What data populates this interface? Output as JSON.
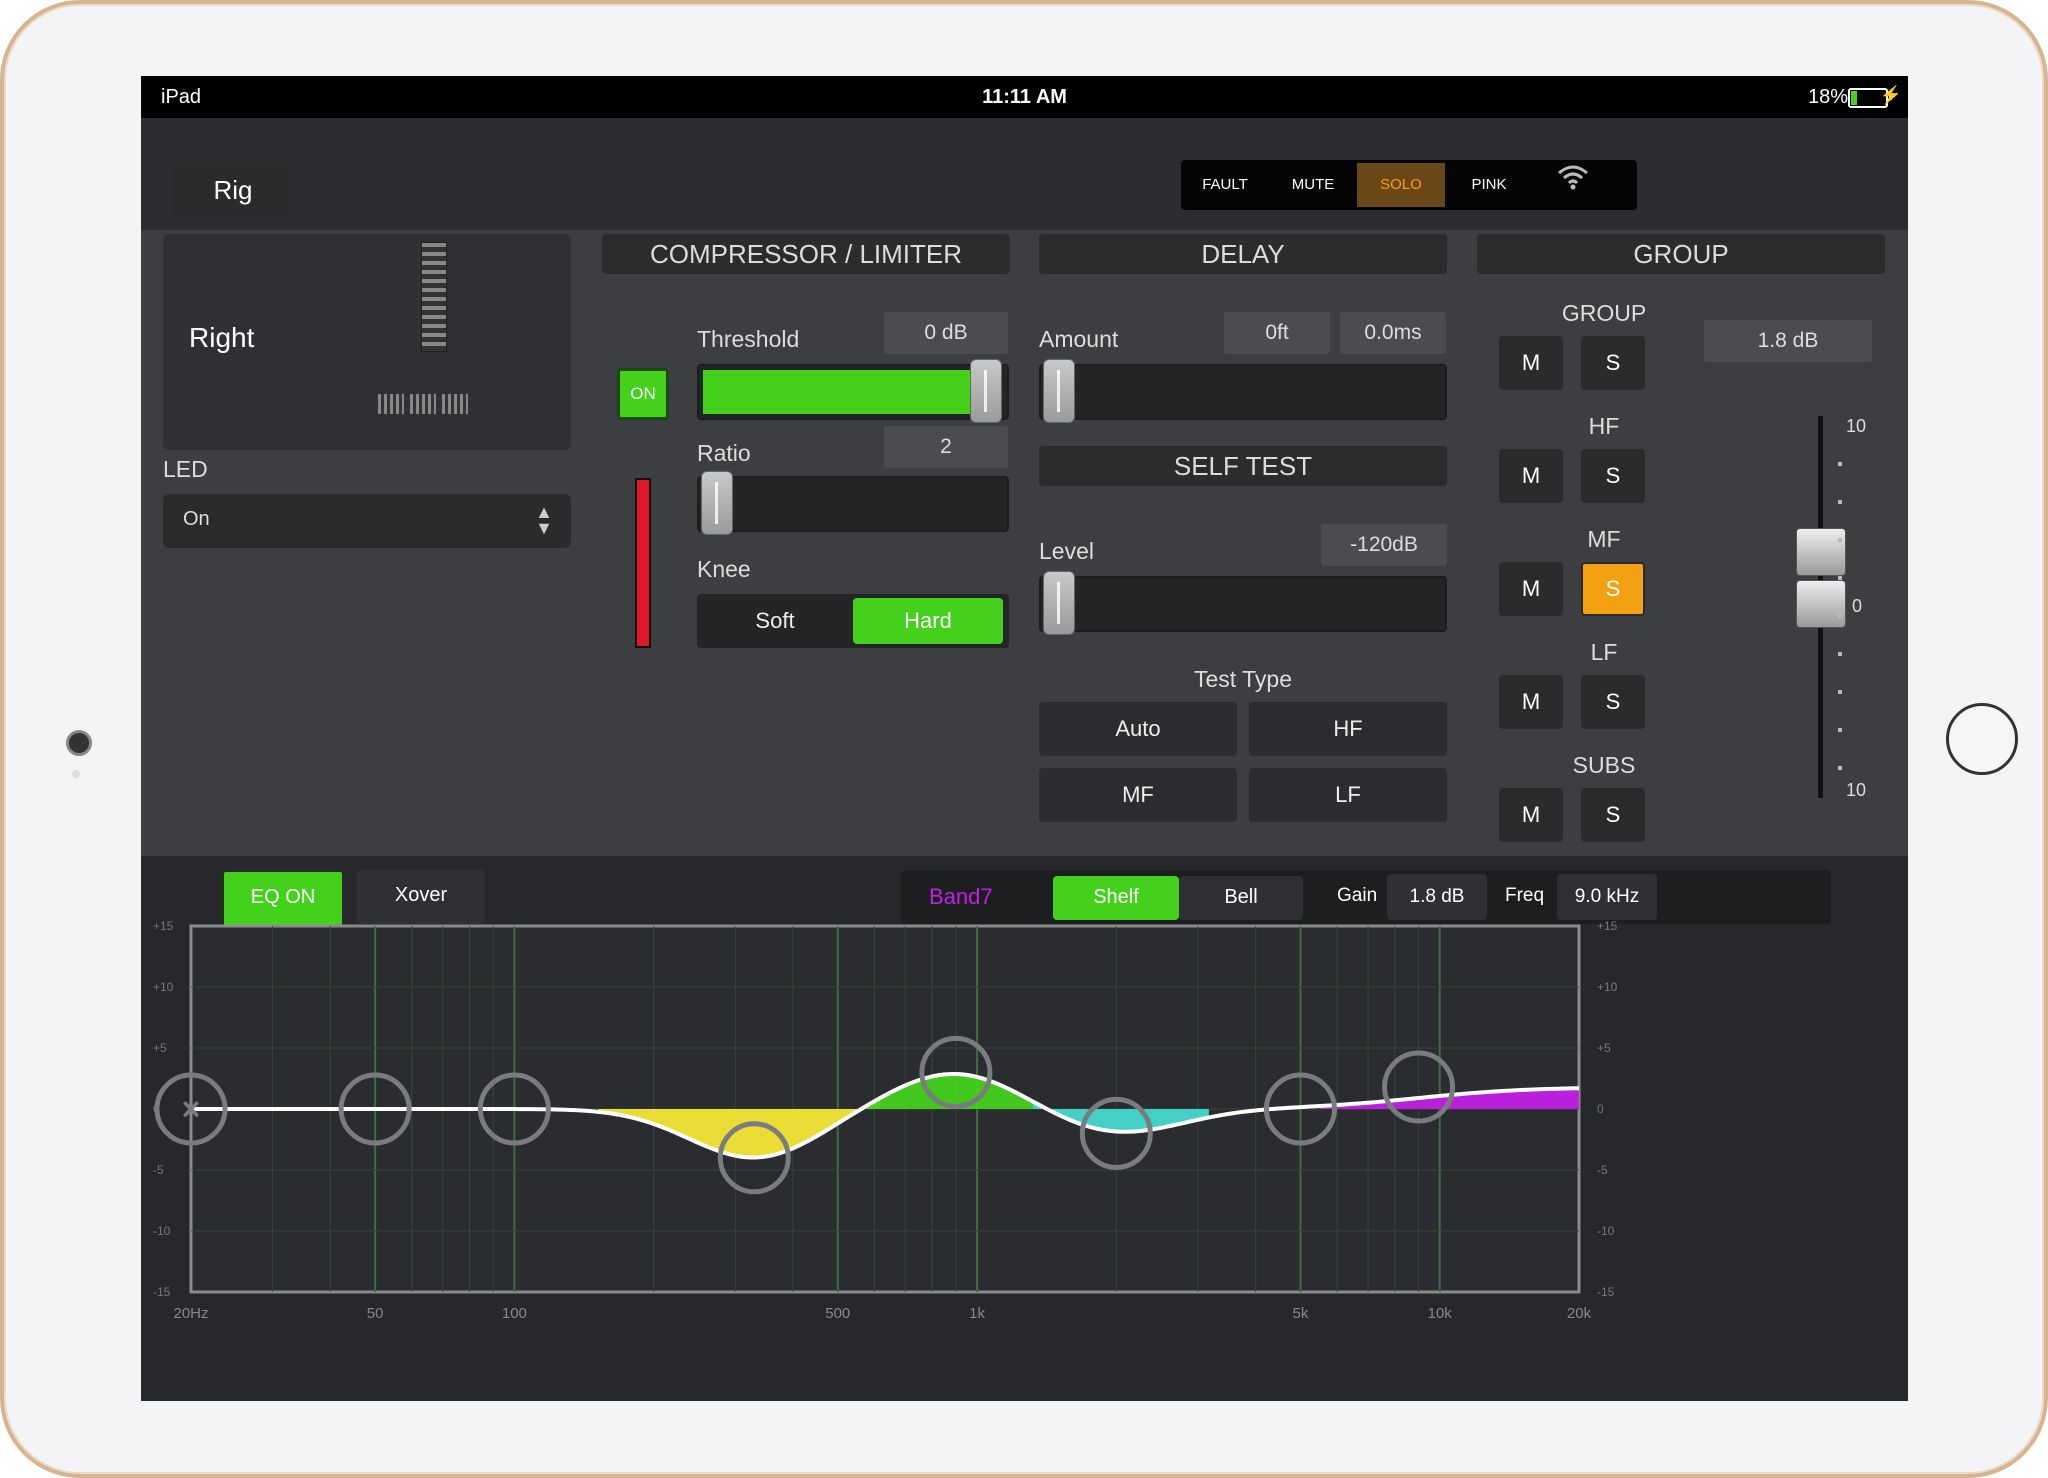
{
  "statusbar": {
    "device": "iPad",
    "time": "11:11 AM",
    "battery": "18%",
    "battery_level": 0.18
  },
  "header": {
    "rig_label": "Rig",
    "indicators": [
      {
        "label": "FAULT",
        "active": false
      },
      {
        "label": "MUTE",
        "active": false
      },
      {
        "label": "SOLO",
        "active": true
      },
      {
        "label": "PINK",
        "active": false
      }
    ],
    "wifi_icon": "wifi-icon"
  },
  "speaker": {
    "name": "Right",
    "led_label": "LED",
    "led_value": "On"
  },
  "compressor": {
    "title": "COMPRESSOR / LIMITER",
    "on_label": "ON",
    "threshold_label": "Threshold",
    "threshold_value": "0 dB",
    "threshold_level": 0.98,
    "ratio_label": "Ratio",
    "ratio_value": "2",
    "ratio_level": 0.0,
    "knee_label": "Knee",
    "knee_options": [
      "Soft",
      "Hard"
    ],
    "knee_selected": "Hard"
  },
  "delay": {
    "title": "DELAY",
    "amount_label": "Amount",
    "amount_ft": "0ft",
    "amount_ms": "0.0ms",
    "amount_level": 0.0,
    "self_test_title": "SELF TEST",
    "level_label": "Level",
    "level_value": "-120dB",
    "level_level": 0.0,
    "test_type_label": "Test Type",
    "test_types": [
      "Auto",
      "HF",
      "MF",
      "LF"
    ]
  },
  "group": {
    "title": "GROUP",
    "gain_value": "1.8 dB",
    "rows": [
      {
        "label": "GROUP",
        "m": "M",
        "s": "S",
        "solo": false
      },
      {
        "label": "HF",
        "m": "M",
        "s": "S",
        "solo": false
      },
      {
        "label": "MF",
        "m": "M",
        "s": "S",
        "solo": true
      },
      {
        "label": "LF",
        "m": "M",
        "s": "S",
        "solo": false
      },
      {
        "label": "SUBS",
        "m": "M",
        "s": "S",
        "solo": false
      }
    ],
    "fader_top_label": "10",
    "fader_mid_label": "0",
    "fader_bottom_label": "10"
  },
  "eq": {
    "eq_on_label": "EQ ON",
    "xover_label": "Xover",
    "band_label": "Band7",
    "shelf_label": "Shelf",
    "bell_label": "Bell",
    "gain_label": "Gain",
    "gain_value": "1.8 dB",
    "freq_label": "Freq",
    "freq_value": "9.0 kHz",
    "y_ticks": [
      "+15",
      "+10",
      "+5",
      "0",
      "-5",
      "-10",
      "-15"
    ],
    "x_ticks": [
      "20Hz",
      "50",
      "100",
      "500",
      "1k",
      "5k",
      "10k",
      "20k"
    ]
  },
  "colors": {
    "accent_green": "#43d11c",
    "solo_orange": "#f3a012",
    "band_purple": "#c21fe6",
    "eq_yellow": "#f5e636",
    "eq_cyan": "#46d8d0",
    "eq_magenta": "#c21fe6"
  },
  "chart_data": {
    "type": "line",
    "x_scale": "log",
    "xlim": [
      20,
      20000
    ],
    "ylim": [
      -15,
      15
    ],
    "x_tick_labels": [
      "20Hz",
      "50",
      "100",
      "500",
      "1k",
      "5k",
      "10k",
      "20k"
    ],
    "y_tick_labels": [
      "+15",
      "+10",
      "+5",
      "0",
      "-5",
      "-10",
      "-15"
    ],
    "bands": [
      {
        "freq": 20,
        "gain": 0
      },
      {
        "freq": 50,
        "gain": 0
      },
      {
        "freq": 100,
        "gain": 0
      },
      {
        "freq": 330,
        "gain": -4
      },
      {
        "freq": 900,
        "gain": 3
      },
      {
        "freq": 2000,
        "gain": -2
      },
      {
        "freq": 5000,
        "gain": 0
      },
      {
        "freq": 9000,
        "gain": 1.8
      }
    ]
  }
}
